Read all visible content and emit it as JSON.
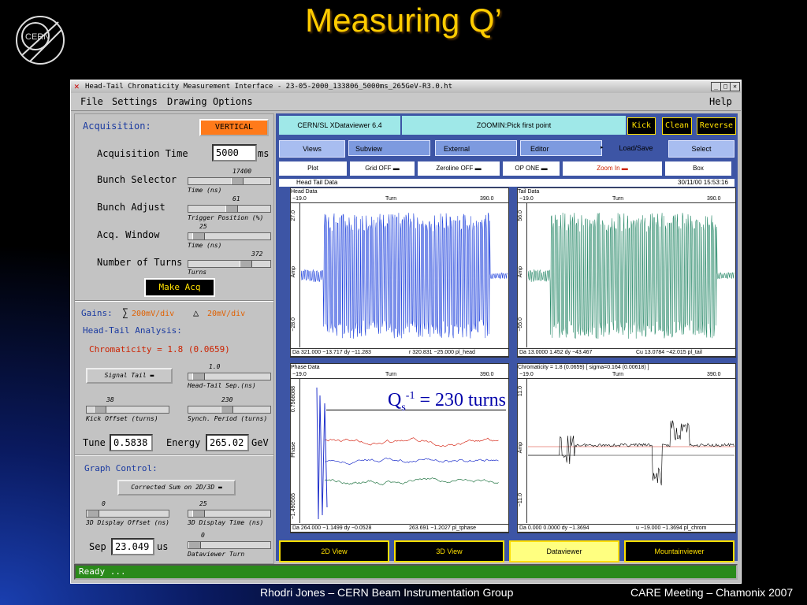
{
  "slide": {
    "title": "Measuring Q’",
    "logo_text": "CERN",
    "footer_left": "Rhodri Jones – CERN Beam Instrumentation Group",
    "footer_right": "CARE Meeting – Chamonix 2007"
  },
  "window": {
    "title": "Head-Tail Chromaticity Measurement Interface - 23-05-2000_133806_5000ms_265GeV-R3.0.ht",
    "menus": [
      "File",
      "Settings",
      "Drawing",
      "Options"
    ],
    "help": "Help",
    "status": "Ready ..."
  },
  "left": {
    "acquisition_label": "Acquisition:",
    "vertical_btn": "VERTICAL",
    "acq_time_label": "Acquisition Time",
    "acq_time_value": "5000",
    "acq_time_unit": "ms",
    "bunch_selector_label": "Bunch Selector",
    "bunch_selector_value": "17400",
    "bunch_selector_fraction": 0.6,
    "bunch_selector_caption": "Time (ns)",
    "bunch_adjust_label": "Bunch Adjust",
    "bunch_adjust_value": "61",
    "bunch_adjust_fraction": 0.52,
    "bunch_adjust_caption": "Trigger Position (%)",
    "acq_window_label": "Acq. Window",
    "acq_window_value": "25",
    "acq_window_fraction": 0.05,
    "acq_window_caption": "Time (ns)",
    "turns_label": "Number of Turns",
    "turns_value": "372",
    "turns_fraction": 0.72,
    "turns_caption": "Turns",
    "make_acq": "Make Acq",
    "gains_label": "Gains:",
    "sum_symbol": "∑",
    "sum_gain": "200mV/div",
    "delta_symbol": "△",
    "delta_gain": "20mV/div",
    "ht_analysis_label": "Head-Tail Analysis:",
    "chromaticity": "Chromaticity = 1.8 (0.0659)",
    "signal_btn": "Signal Tail",
    "sep_value": "1.0",
    "sep_fraction": 0.05,
    "sep_caption": "Head-Tail Sep.(ns)",
    "kick_value": "38",
    "kick_fraction": 0.1,
    "kick_caption": "Kick Offset (turns)",
    "synch_value": "230",
    "synch_fraction": 0.45,
    "synch_caption": "Synch. Period (turns)",
    "tune_label": "Tune",
    "tune_value": "0.5838",
    "energy_label": "Energy",
    "energy_value": "265.02",
    "energy_unit": "GeV",
    "graph_control_label": "Graph Control:",
    "corrected_btn": "Corrected Sum on 2D/3D",
    "display_offset_value": "0",
    "display_offset_fraction": 0.0,
    "display_offset_caption": "3D Display Offset (ns)",
    "display_time_value": "25",
    "display_time_fraction": 0.05,
    "display_time_caption": "3D Display Time (ns)",
    "sep_label": "Sep",
    "sep_field": "23.049",
    "sep_unit": "us",
    "dv_turn_value": "0",
    "dv_turn_fraction": 0.0,
    "dv_turn_caption": "Dataviewer Turn"
  },
  "viewer": {
    "app_name": "CERN/SL XDataviewer 6.4",
    "zoom_msg": "ZOOMIN:Pick first point",
    "kick": "Kick",
    "clean": "Clean",
    "reverse": "Reverse",
    "tabs": [
      "Views",
      "Subview",
      "External",
      "Editor",
      "Load/Save",
      "Select"
    ],
    "options": [
      "Plot",
      "Grid OFF",
      "Zeroline OFF",
      "OP ONE",
      "Zoom In",
      "Box"
    ],
    "panel_title": "Head Tail Data",
    "date": "30/11/00 15:53:16",
    "plots": [
      {
        "title": "Head Data",
        "left": "−19.0",
        "mid": "Turn",
        "right": "390.0",
        "ytop": "27.0",
        "ymid": "Amp",
        "ybot": "−28.0",
        "footer_a": "Da 321.000 −13.717 dy −11.283",
        "footer_b": "r 320.831 −25.000 pl_head"
      },
      {
        "title": "Tail Data",
        "left": "−19.0",
        "mid": "Turn",
        "right": "390.0",
        "ytop": "56.0",
        "ymid": "Amp",
        "ybot": "−55.0",
        "footer_a": "Da 13.0000   1.452 dy −43.467",
        "footer_b": "Cu 13.0784 −42.015 pl_tail"
      },
      {
        "title": "Phase Data",
        "left": "−19.0",
        "mid": "Turn",
        "right": "390.0",
        "ytop": "0.7568088",
        "ymid": "Phase",
        "ybot": "−1.490565",
        "footer_a": "Da 264.000 −1.1499 dy −0.0528",
        "footer_b": "263.691 −1.2027 pl_tphase"
      },
      {
        "title": "Chromaticity = 1.8   (0.0659)  [ sigma=0.164 (0.00618) ]",
        "left": "−19.0",
        "mid": "Turn",
        "right": "390.0",
        "ytop": "11.0",
        "ymid": "Amp",
        "ybot": "−11.0",
        "footer_a": "Da   0.000  0.0000 dy −1.3694",
        "footer_b": "u −19.000 −1.3694 pl_chrom"
      }
    ],
    "annotation_q": "Q",
    "annotation_sub": "s",
    "annotation_sup": "-1",
    "annotation_rest": " = 230 turns",
    "bottom_tabs": [
      "2D View",
      "3D View",
      "Dataviewer",
      "Mountainviewer"
    ]
  }
}
